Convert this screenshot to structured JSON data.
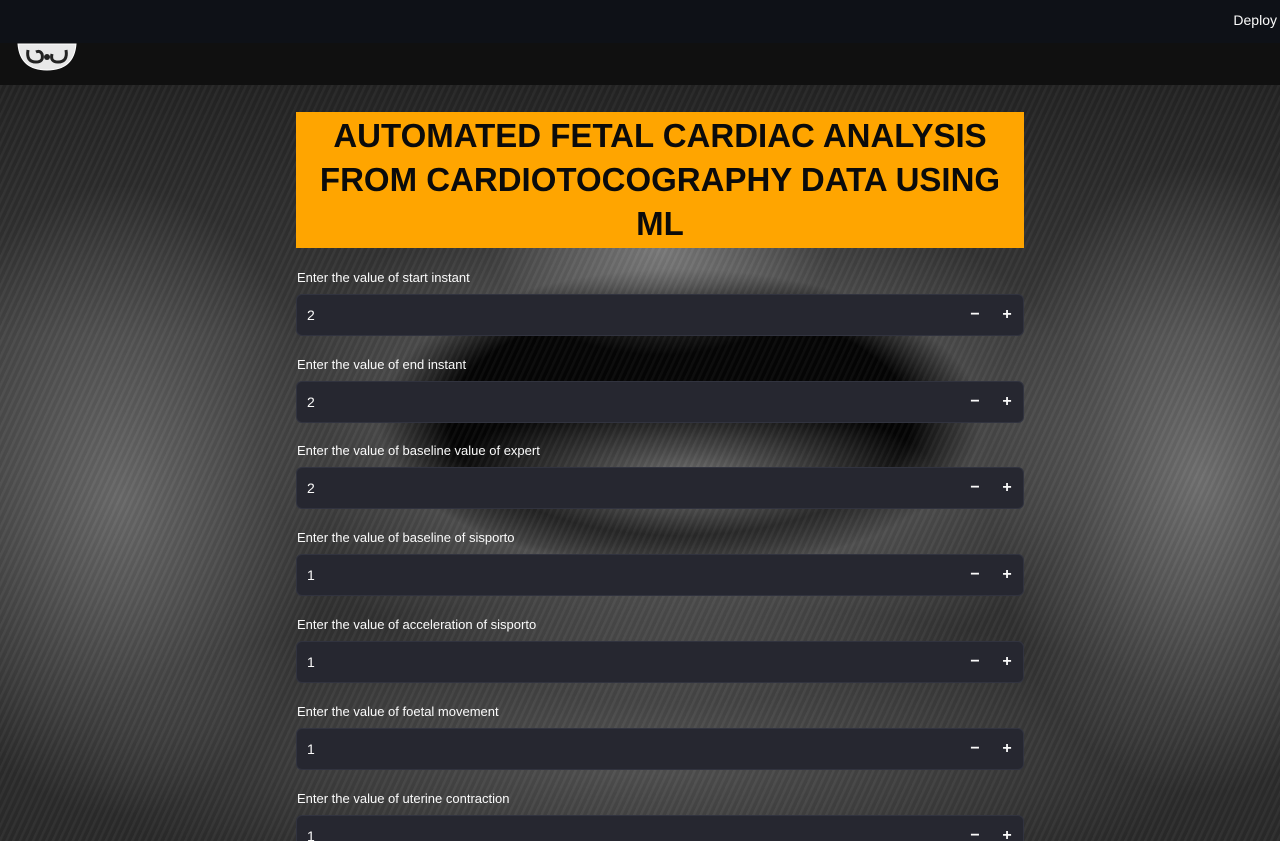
{
  "header": {
    "deploy_label": "Deploy"
  },
  "page": {
    "title": "AUTOMATED FETAL CARDIAC ANALYSIS FROM CARDIOTOCOGRAPHY DATA USING ML"
  },
  "fields": [
    {
      "label": "Enter the value of start instant",
      "value": "2"
    },
    {
      "label": "Enter the value of end instant",
      "value": "2"
    },
    {
      "label": "Enter the value of baseline value of expert",
      "value": "2"
    },
    {
      "label": "Enter the value of baseline of sisporto",
      "value": "1"
    },
    {
      "label": "Enter the value of acceleration of sisporto",
      "value": "1"
    },
    {
      "label": "Enter the value of foetal movement",
      "value": "1"
    },
    {
      "label": "Enter the value of uterine contraction",
      "value": "1"
    }
  ],
  "stepper": {
    "minus": "−",
    "plus": "+"
  },
  "colors": {
    "accent": "#ffa500",
    "header_bg": "#0e1117",
    "input_bg": "#262730"
  }
}
